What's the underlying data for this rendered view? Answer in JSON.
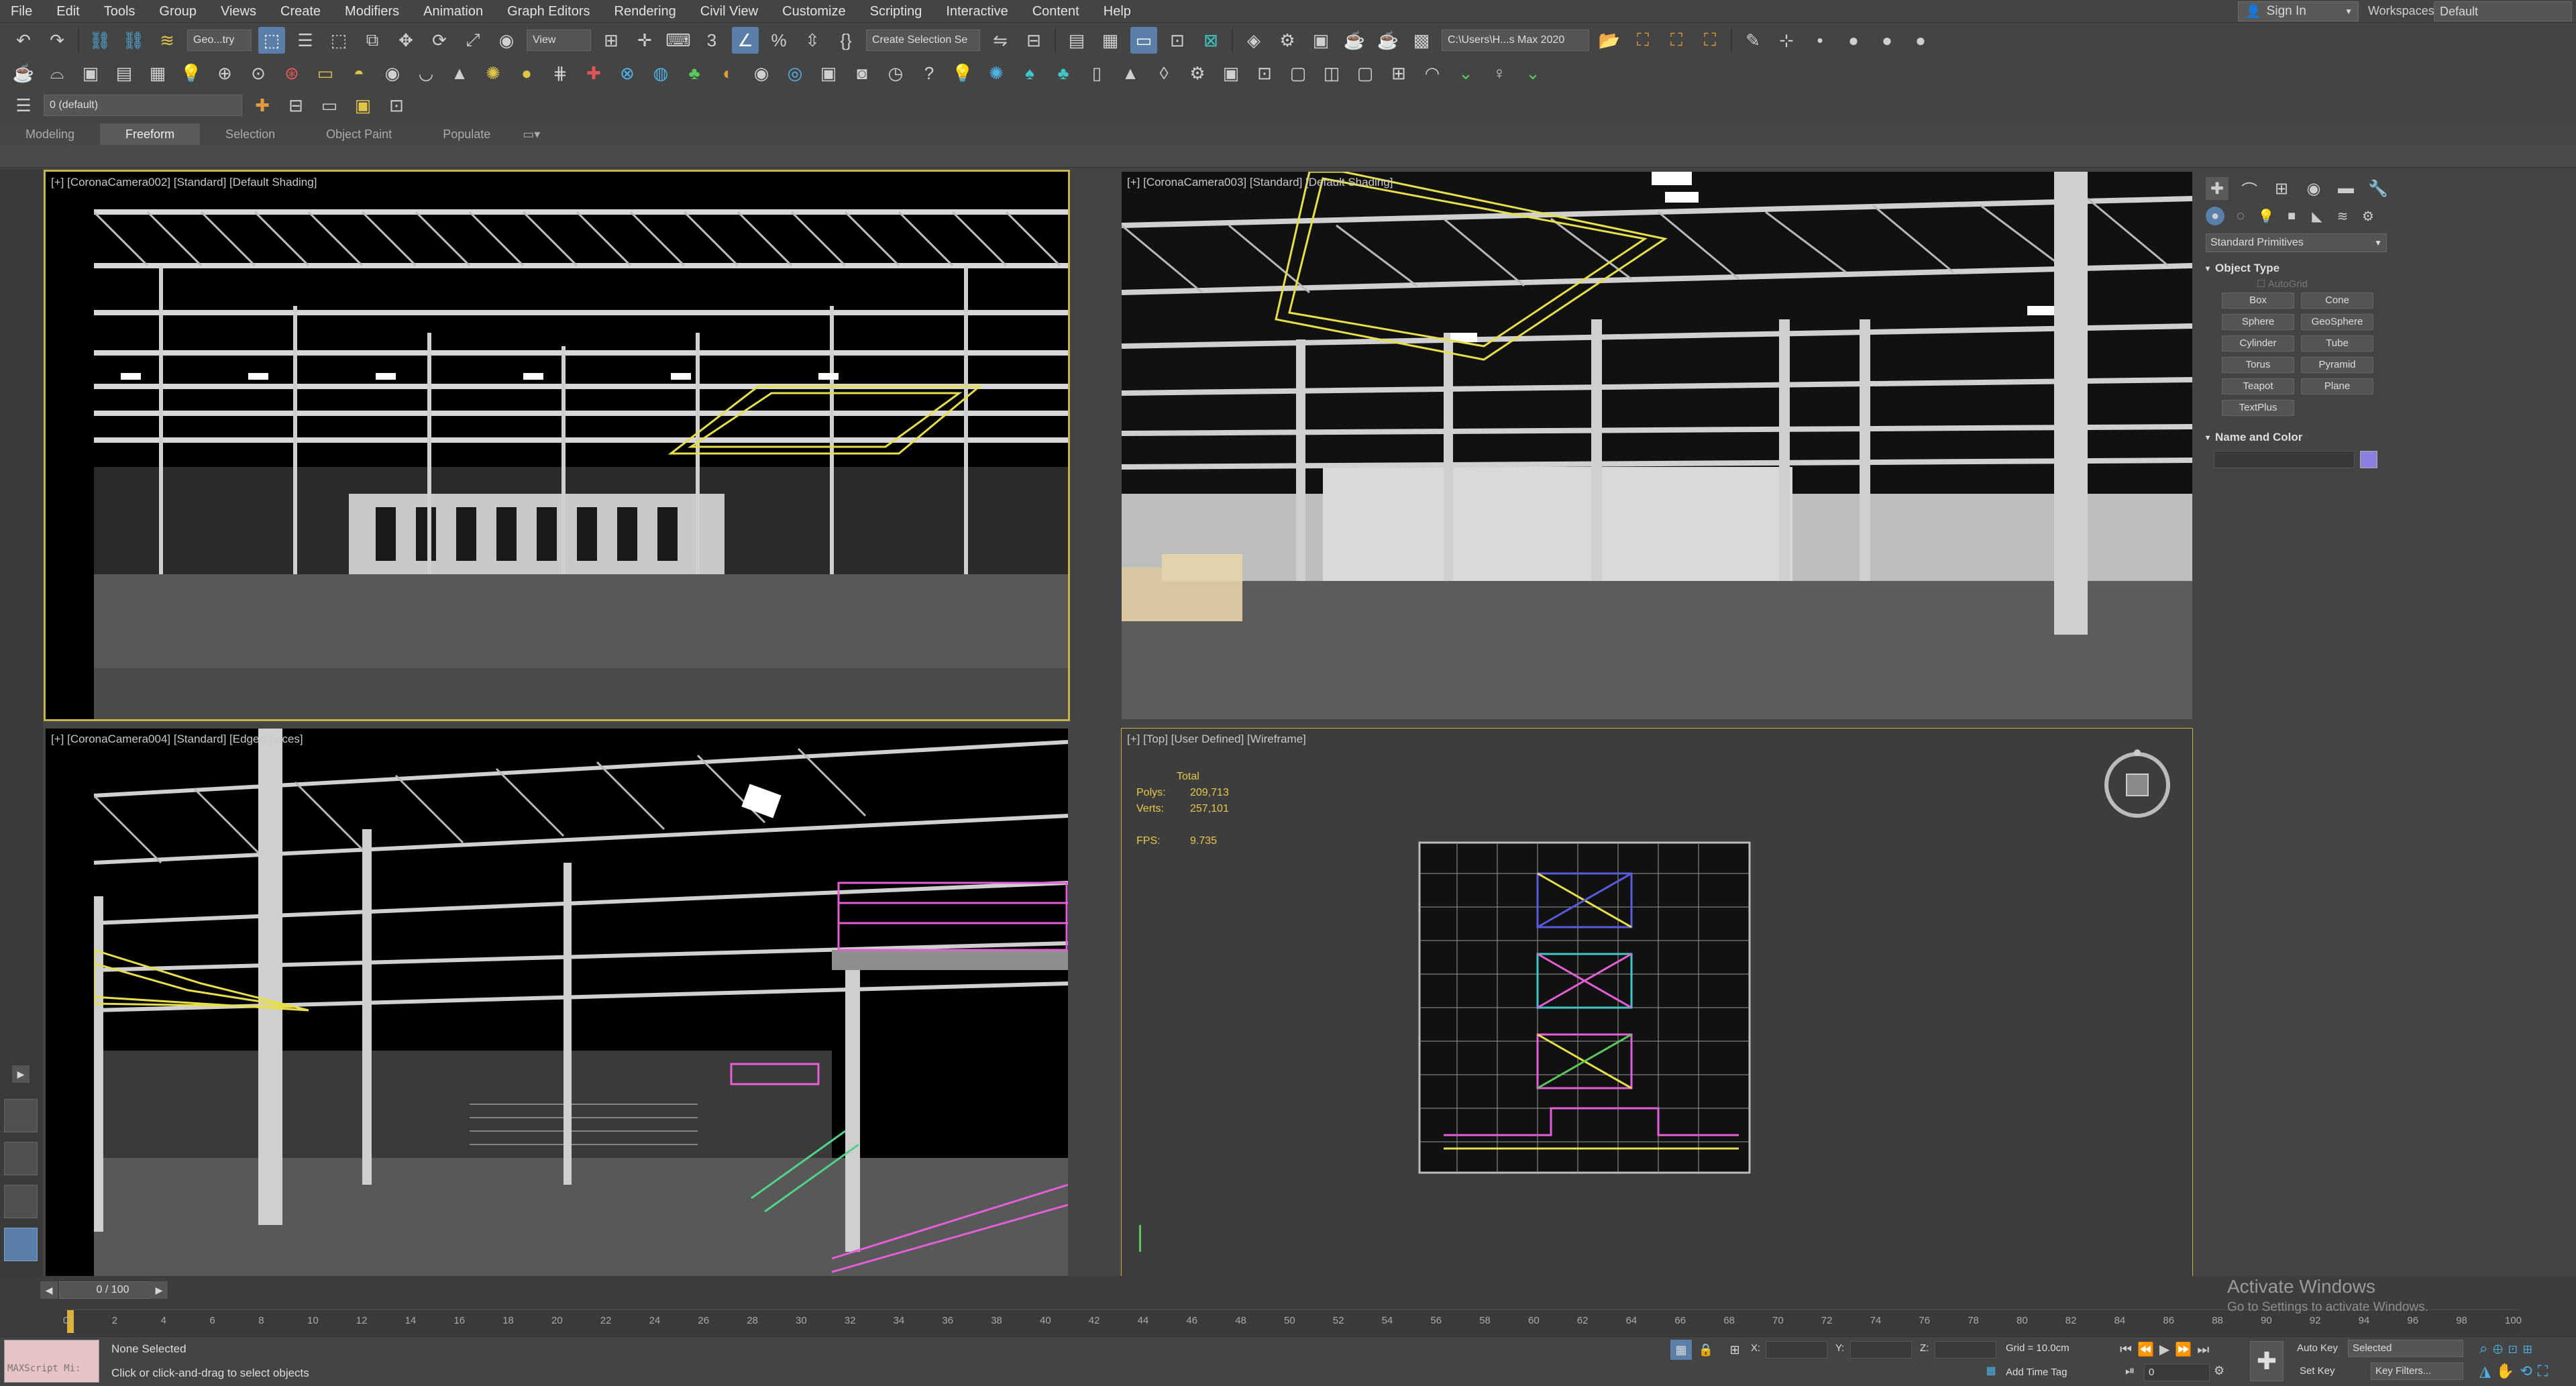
{
  "menu": [
    "File",
    "Edit",
    "Tools",
    "Group",
    "Views",
    "Create",
    "Modifiers",
    "Animation",
    "Graph Editors",
    "Rendering",
    "Civil View",
    "Customize",
    "Scripting",
    "Interactive",
    "Content",
    "Help"
  ],
  "signin": {
    "label": "Sign In",
    "icon": "user-icon"
  },
  "workspace": {
    "label": "Workspaces:",
    "value": "Default"
  },
  "toolbar": {
    "selection_filter": "Geo...try",
    "ref_coord": "View",
    "named_selection": "Create Selection Se",
    "project_path": "C:\\Users\\H...s Max 2020",
    "layer": "0 (default)"
  },
  "ribbon": {
    "tabs": [
      "Modeling",
      "Freeform",
      "Selection",
      "Object Paint",
      "Populate"
    ],
    "active": "Freeform"
  },
  "viewports": [
    {
      "label": "[+] [CoronaCamera002] [Standard] [Default Shading]"
    },
    {
      "label": "[+] [CoronaCamera003] [Standard] [Default Shading]"
    },
    {
      "label": "[+] [CoronaCamera004] [Standard] [Edged Faces]"
    },
    {
      "label": "[+] [Top] [User Defined] [Wireframe]"
    }
  ],
  "stats": {
    "title": "Total",
    "polys_label": "Polys:",
    "polys": "209,713",
    "verts_label": "Verts:",
    "verts": "257,101",
    "fps_label": "FPS:",
    "fps": "9.735"
  },
  "command_panel": {
    "dropdown": "Standard Primitives",
    "object_type": "Object Type",
    "autogrid": "AutoGrid",
    "buttons": [
      "Box",
      "Cone",
      "Sphere",
      "GeoSphere",
      "Cylinder",
      "Tube",
      "Torus",
      "Pyramid",
      "Teapot",
      "Plane",
      "TextPlus"
    ],
    "name_and_color": "Name and Color",
    "color": "#8a7fe0"
  },
  "timeline": {
    "range": "0 / 100",
    "ticks": [
      "0",
      "2",
      "4",
      "6",
      "8",
      "10",
      "12",
      "14",
      "16",
      "18",
      "20",
      "22",
      "24",
      "26",
      "28",
      "30",
      "32",
      "34",
      "36",
      "38",
      "40",
      "42",
      "44",
      "46",
      "48",
      "50",
      "52",
      "54",
      "56",
      "58",
      "60",
      "62",
      "64",
      "66",
      "68",
      "70",
      "72",
      "74",
      "76",
      "78",
      "80",
      "82",
      "84",
      "86",
      "88",
      "90",
      "92",
      "94",
      "96",
      "98",
      "100"
    ]
  },
  "status": {
    "maxscript": "MAXScript Mi:",
    "selection": "None Selected",
    "prompt": "Click or click-and-drag to select objects",
    "x": "X:",
    "y": "Y:",
    "z": "Z:",
    "grid": "Grid = 10.0cm",
    "add_time_tag": "Add Time Tag",
    "auto_key": "Auto Key",
    "set_key": "Set Key",
    "selected": "Selected",
    "key_filters": "Key Filters...",
    "frame": "0"
  },
  "activate": {
    "title": "Activate Windows",
    "subtitle": "Go to Settings to activate Windows."
  }
}
